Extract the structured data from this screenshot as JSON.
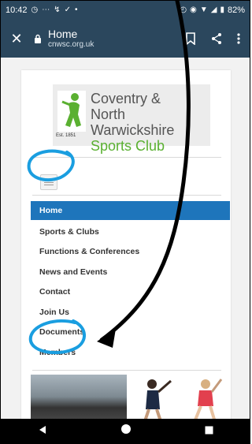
{
  "status_bar": {
    "time": "10:42",
    "battery": "82%"
  },
  "toolbar": {
    "title": "Home",
    "url": "cnwsc.org.uk"
  },
  "logo": {
    "line1": "Coventry &",
    "line2": "North Warwickshire",
    "line3": "Sports Club",
    "established": "Est. 1851"
  },
  "menu": {
    "items": [
      {
        "label": "Home",
        "active": true
      },
      {
        "label": "Sports & Clubs"
      },
      {
        "label": "Functions & Conferences"
      },
      {
        "label": "News and Events"
      },
      {
        "label": "Contact"
      },
      {
        "label": "Join Us"
      },
      {
        "label": "Documents"
      },
      {
        "label": "Members"
      }
    ]
  },
  "colors": {
    "toolbar": "#2b475d",
    "menu_active": "#1e75bb",
    "logo_green": "#5ab031",
    "annotation_blue": "#1a9ee0",
    "annotation_arrow": "#000000"
  },
  "icons": {
    "close": "close-icon",
    "lock": "lock-icon",
    "bookmark": "bookmark-icon",
    "share": "share-icon",
    "more": "more-vert-icon",
    "back": "back-triangle-icon",
    "home": "home-circle-icon",
    "recents": "recents-square-icon"
  }
}
